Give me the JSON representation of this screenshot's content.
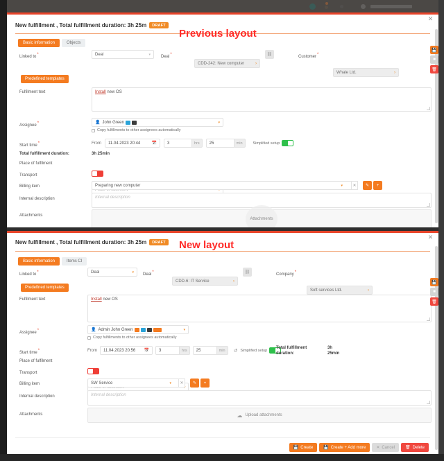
{
  "annotations": {
    "previous": "Previous layout",
    "new": "New layout"
  },
  "common": {
    "dialog_title": "New fulfillment , Total fulfillment duration: 3h 25m",
    "draft_badge": "DRAFT",
    "close_icon": "✕",
    "labels": {
      "linked_to": "Linked to",
      "fulfilment_text": "Fulfilment text",
      "assignee": "Assignee",
      "start_time": "Start time",
      "total_duration": "Total fulfillment duration:",
      "place_of_fulfilment": "Place of fulfilment",
      "transport": "Transport",
      "billing_item": "Billing item",
      "internal_description": "Internal description",
      "attachments": "Attachments",
      "from": "From",
      "required_mark": "*"
    },
    "copy_checkbox": "Copy fulfillments to other assignees automatically",
    "simplified_setup": "Simplified setup",
    "predefined_templates": "Predefined templates",
    "fulfilment_text_link": "Install",
    "fulfilment_text_rest": " new OS",
    "internal_description_placeholder": "Internal description",
    "place_placeholder": "Place of fulfilment",
    "hrs_unit": "hrs",
    "min_unit": "min",
    "duration_hours": "3",
    "duration_minutes": "25",
    "side_buttons": [
      {
        "name": "save",
        "icon": "■"
      },
      {
        "name": "cancel",
        "icon": "■"
      },
      {
        "name": "delete",
        "icon": "■"
      }
    ]
  },
  "previous": {
    "tabs": [
      {
        "label": "Basic information",
        "active": true
      },
      {
        "label": "Objects",
        "active": false
      }
    ],
    "linked_to_value": "Deal",
    "second_label": "Deal",
    "second_value": "CDD-242: New computer",
    "third_label": "Customer",
    "third_value": "Whale Ltd.",
    "assignee_value": "John Green",
    "assignee_badges": [
      "blue",
      "dark"
    ],
    "start_datetime": "11.04.2023 20:44",
    "total_duration_value": "3h 25min",
    "transport_toggle": "off",
    "simplified_toggle": "on",
    "billing_item_value": "Preparing new computer",
    "attachments_label": "Attachments"
  },
  "new": {
    "tabs": [
      {
        "label": "Basic information",
        "active": true
      },
      {
        "label": "Items CI",
        "active": false
      }
    ],
    "linked_to_value": "Deal",
    "second_label": "Deal",
    "second_value": "CDD-6: IT Service",
    "third_label": "Company",
    "third_value": "Soft services Ltd.",
    "assignee_value": "Admin John Green",
    "assignee_badges": [
      "orange",
      "blue",
      "dark",
      "orange-wide"
    ],
    "start_datetime": "11.04.2023 20:56",
    "total_duration_label_l1": "Total fulfillment",
    "total_duration_label_l2": "duration:",
    "total_duration_v1": "3h",
    "total_duration_v2": "25min",
    "transport_toggle": "off",
    "simplified_toggle": "on",
    "billing_item_value": "SW Service",
    "attachments_label": "Upload attachments",
    "footer_buttons": [
      {
        "label": "Create",
        "style": "primary",
        "icon": "💾"
      },
      {
        "label": "Create + Add more",
        "style": "primary",
        "icon": "💾"
      },
      {
        "label": "Cancel",
        "style": "cancel",
        "icon": "✕"
      },
      {
        "label": "Delete",
        "style": "danger",
        "icon": "🗑"
      }
    ]
  },
  "colors": {
    "accent_orange": "#f47b20",
    "accent_red": "#e8442a",
    "toggle_on": "#2ec04b",
    "toggle_off": "#ef3e36",
    "annotation_red": "#ff2b28"
  }
}
